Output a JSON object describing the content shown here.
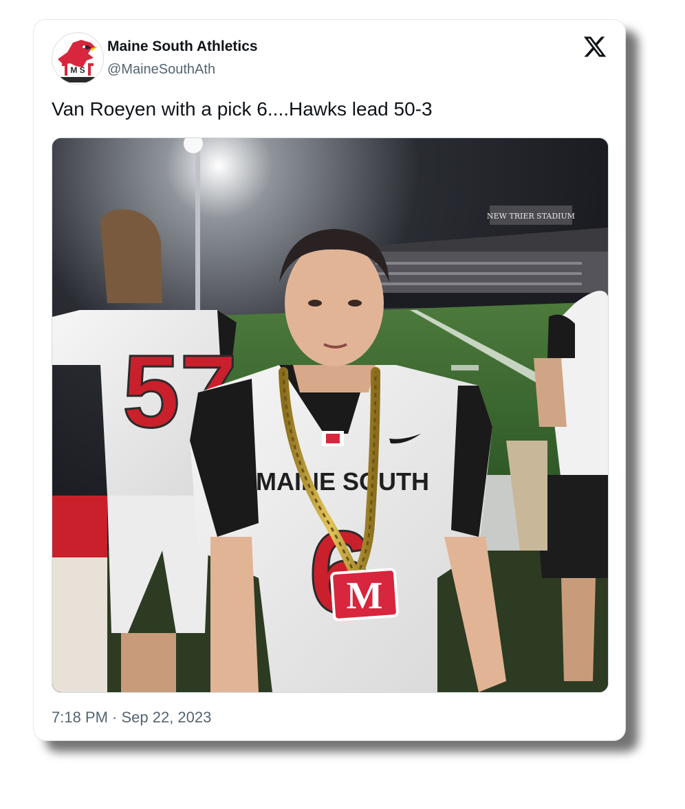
{
  "tweet": {
    "author": {
      "display_name": "Maine South Athletics",
      "handle": "@MaineSouthAth",
      "avatar_icon": "hawk-logo-icon",
      "avatar_logo_text": "M S"
    },
    "platform_icon": "x-logo-icon",
    "text": "Van Roeyen with a pick 6....Hawks lead 50-3",
    "media": {
      "stadium_sign": "NEW TRIER STADIUM",
      "jersey_left_number": "57",
      "jersey_main_text": "MAINE SOUTH",
      "jersey_main_number": "6",
      "pendant_text": "M",
      "brand_color": "#d7263d"
    },
    "timestamp": "7:18 PM · Sep 22, 2023"
  }
}
